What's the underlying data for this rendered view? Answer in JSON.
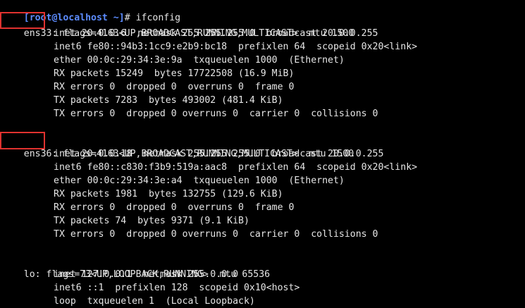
{
  "prompt": {
    "user_host": "[root@localhost ~]",
    "symbol": "# ",
    "command": "ifconfig"
  },
  "interfaces": [
    {
      "name": "ens33:",
      "flags": " flags=4163<UP,BROADCAST,RUNNING,MULTICAST>  mtu 1500",
      "lines": [
        "inet 20.0.0.6  netmask 255.255.255.0  broadcast 20.0.0.255",
        "inet6 fe80::94b3:1cc9:e2b9:bc18  prefixlen 64  scopeid 0x20<link>",
        "ether 00:0c:29:34:3e:9a  txqueuelen 1000  (Ethernet)",
        "RX packets 15249  bytes 17722508 (16.9 MiB)",
        "RX errors 0  dropped 0  overruns 0  frame 0",
        "TX packets 7283  bytes 493002 (481.4 KiB)",
        "TX errors 0  dropped 0 overruns 0  carrier 0  collisions 0"
      ]
    },
    {
      "name": "ens36:",
      "flags": " flags=4163<UP,BROADCAST,RUNNING,MULTICAST>  mtu 1500",
      "lines": [
        "inet 20.0.0.18  netmask 255.255.255.0  broadcast 20.0.0.255",
        "inet6 fe80::c830:f3b9:519a:aac8  prefixlen 64  scopeid 0x20<link>",
        "ether 00:0c:29:34:3e:a4  txqueuelen 1000  (Ethernet)",
        "RX packets 1981  bytes 132755 (129.6 KiB)",
        "RX errors 0  dropped 0  overruns 0  frame 0",
        "TX packets 74  bytes 9371 (9.1 KiB)",
        "TX errors 0  dropped 0 overruns 0  carrier 0  collisions 0"
      ]
    },
    {
      "name": "lo:",
      "flags": " flags=73<UP,LOOPBACK,RUNNING>  mtu 65536",
      "lines": [
        "inet 127.0.0.1  netmask 255.0.0.0",
        "inet6 ::1  prefixlen 128  scopeid 0x10<host>",
        "loop  txqueuelen 1  (Local Loopback)"
      ]
    }
  ],
  "colors": {
    "background": "#000000",
    "text": "#e6e6e6",
    "prompt": "#5c8cff",
    "highlight": "#e0322f"
  }
}
